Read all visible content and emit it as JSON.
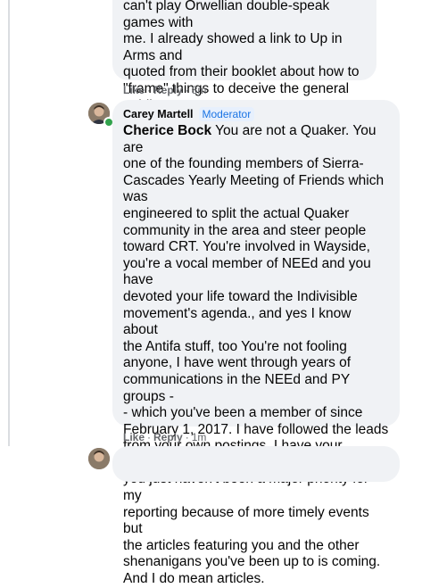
{
  "comment_prev": {
    "text": "can't play Orwellian double-speak games with\nme. I already showed a link to Up in Arms and\nquoted from their booklet about how to\n\"frame\" things to deceive the general public.\nYou're not fooling anybody anymore.",
    "like_label": "Like",
    "reply_label": "Reply",
    "separator": "·",
    "time": "8m"
  },
  "comment_main": {
    "author": "Carey Martell",
    "badge": "Moderator",
    "mention": "Cherice Bock",
    "text": " You are not a Quaker. You are\none of the founding members of Sierra-\nCascades Yearly Meeting of Friends which was\nengineered to split the actual Quaker\ncommunity in the area and steer people\ntoward CRT. You're involved in Wayside,\nyou're a vocal member of NEEd and you have\ndevoted your life toward the Indivisible\nmovement's agenda., and yes I know about\nthe Antifa stuff, too You're not fooling\nanyone, I have went through years of\ncommunications in the NEEd and PY groups -\n- which you've been a member of since\nFebruary 1, 2017. I have followed the leads\nfrom your own postings. I have your number,\nyou just haven't been a major priority for my\nreporting because of more timely events but\nthe articles featuring you and the other\nshenanigans you've been up to is coming.\nAnd I do mean articles.",
    "like_label": "Like",
    "reply_label": "Reply",
    "separator": "·",
    "time": "1m"
  },
  "colors": {
    "bubble": "#f0f2f5",
    "meta_text": "#65676b",
    "moderator_badge": "#1b74e4",
    "online_status": "#31a24c"
  }
}
